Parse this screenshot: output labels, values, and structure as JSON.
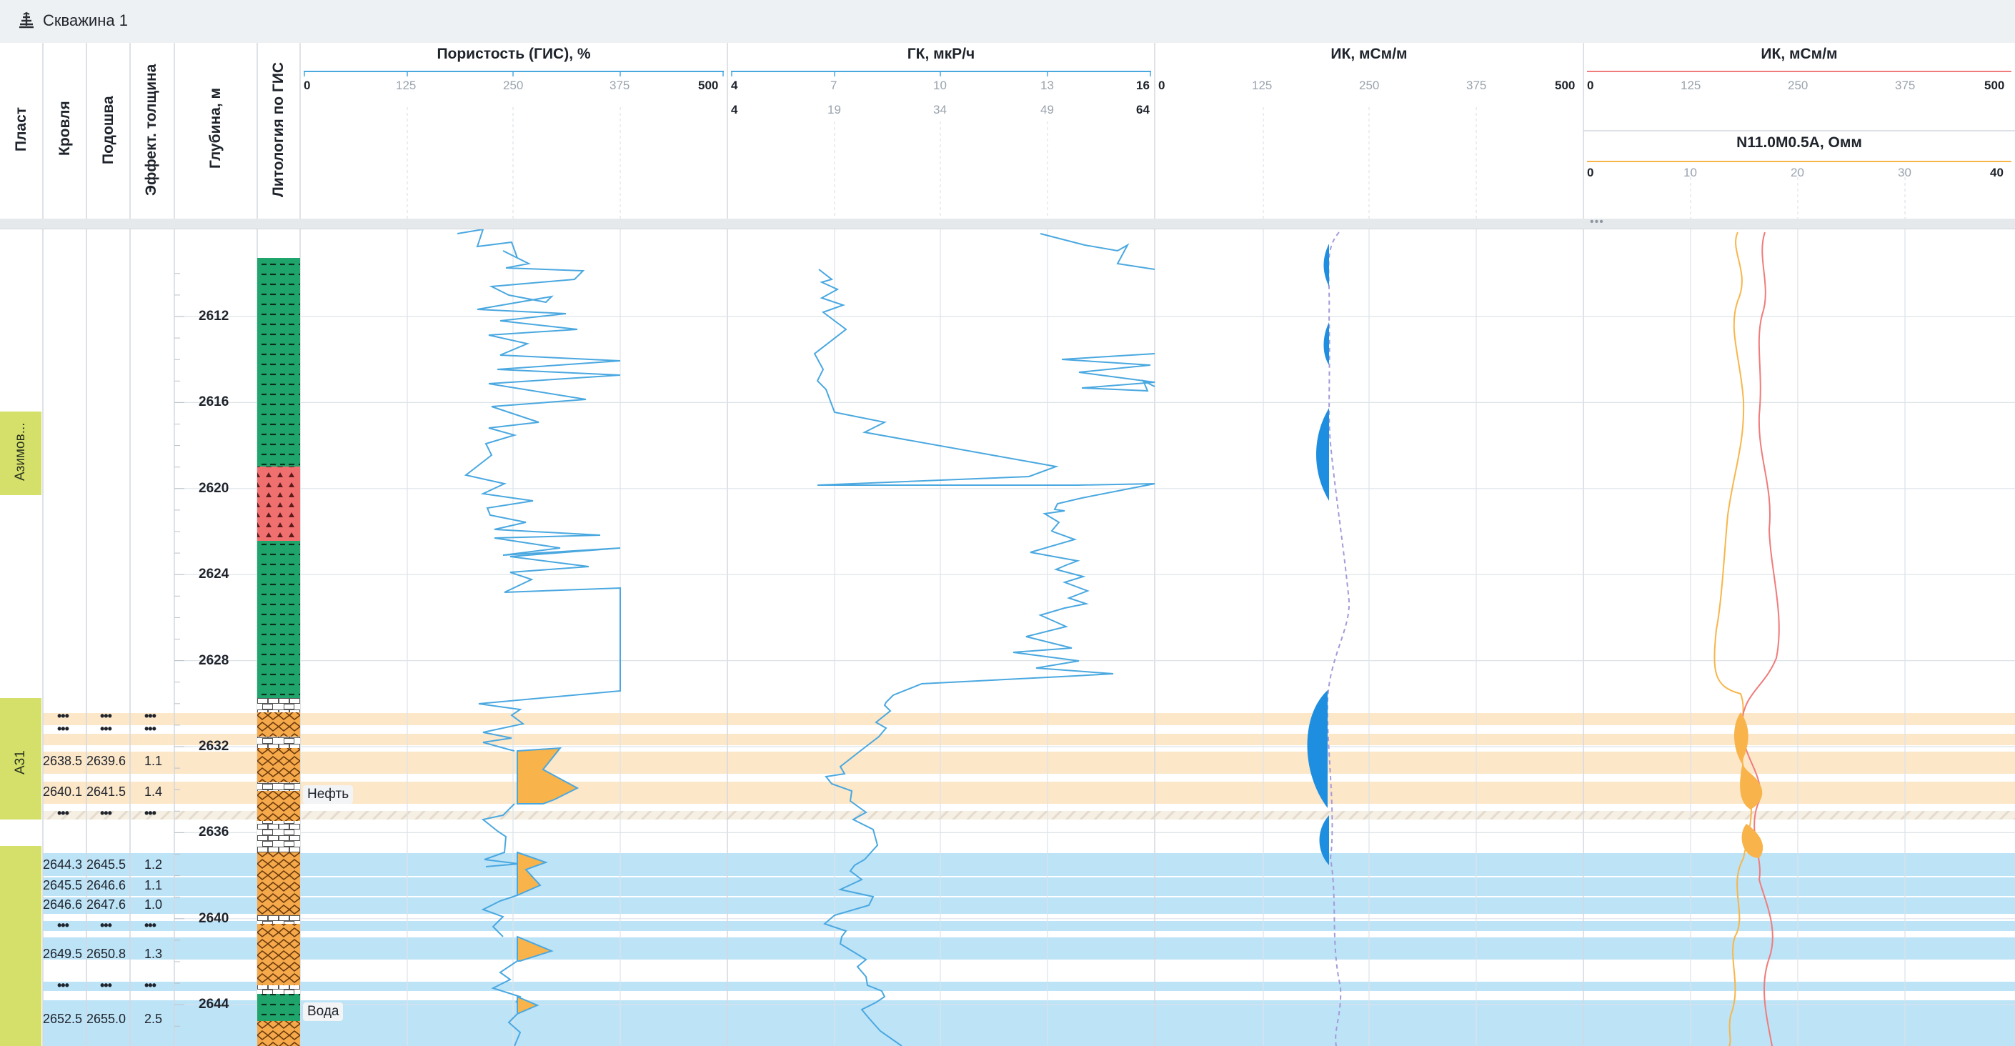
{
  "window": {
    "title": "Скважина 1"
  },
  "columns": {
    "plast": "Пласт",
    "krovlya": "Кровля",
    "podoshva": "Подошва",
    "eff_thickness": "Эффект. толщина",
    "depth": "Глубина, м",
    "lithology": "Литология по ГИС"
  },
  "tracks": [
    {
      "title": "Пористость (ГИС), %",
      "scale": [
        "0",
        "125",
        "250",
        "375",
        "500"
      ],
      "color": "#4aa8e0"
    },
    {
      "title": "ГК, мкР/ч",
      "scale": [
        "4",
        "7",
        "10",
        "13",
        "16"
      ],
      "scale2": [
        "4",
        "19",
        "34",
        "49",
        "64"
      ],
      "color": "#4aa8e0"
    },
    {
      "title": "ИК, мСм/м",
      "scale": [
        "0",
        "125",
        "250",
        "375",
        "500"
      ],
      "gradient": [
        "#5b2bd6",
        "#f7c03a",
        "#f06a2f"
      ]
    },
    {
      "title": "ИК, мСм/м",
      "scale": [
        "0",
        "125",
        "250",
        "375",
        "500"
      ],
      "color": "#f07b7b",
      "subtitle": "N11.0M0.5A, Омм",
      "subscale": [
        "0",
        "10",
        "20",
        "30",
        "40"
      ],
      "subcolor": "#f7b64a"
    }
  ],
  "depth_ticks": [
    "2612",
    "2616",
    "2620",
    "2624",
    "2628",
    "2632",
    "2636",
    "2640",
    "2644"
  ],
  "plasts": [
    {
      "name": "Азимов...",
      "color": "#d5e06a"
    },
    {
      "name": "А31",
      "color": "#d5e06a"
    },
    {
      "name": "",
      "color": "#d5e06a"
    }
  ],
  "intervals": [
    {
      "top": "•••",
      "bottom": "•••",
      "thick": "•••"
    },
    {
      "top": "•••",
      "bottom": "•••",
      "thick": "•••"
    },
    {
      "top": "2638.5",
      "bottom": "2639.6",
      "thick": "1.1"
    },
    {
      "top": "2640.1",
      "bottom": "2641.5",
      "thick": "1.4"
    },
    {
      "top": "•••",
      "bottom": "•••",
      "thick": "•••"
    },
    {
      "top": "2644.3",
      "bottom": "2645.5",
      "thick": "1.2"
    },
    {
      "top": "2645.5",
      "bottom": "2646.6",
      "thick": "1.1"
    },
    {
      "top": "2646.6",
      "bottom": "2647.6",
      "thick": "1.0"
    },
    {
      "top": "•••",
      "bottom": "•••",
      "thick": "•••"
    },
    {
      "top": "2649.5",
      "bottom": "2650.8",
      "thick": "1.3"
    },
    {
      "top": "•••",
      "bottom": "•••",
      "thick": "•••"
    },
    {
      "top": "2652.5",
      "bottom": "2655.0",
      "thick": "2.5"
    }
  ],
  "fluids": {
    "oil": "Нефть",
    "water": "Вода"
  },
  "colors": {
    "oil": "#fce7c9",
    "water": "#bde3f7",
    "fill": "#f8b34a",
    "ik_fill": "#1e8fe0",
    "grid": "#dde3e8"
  }
}
